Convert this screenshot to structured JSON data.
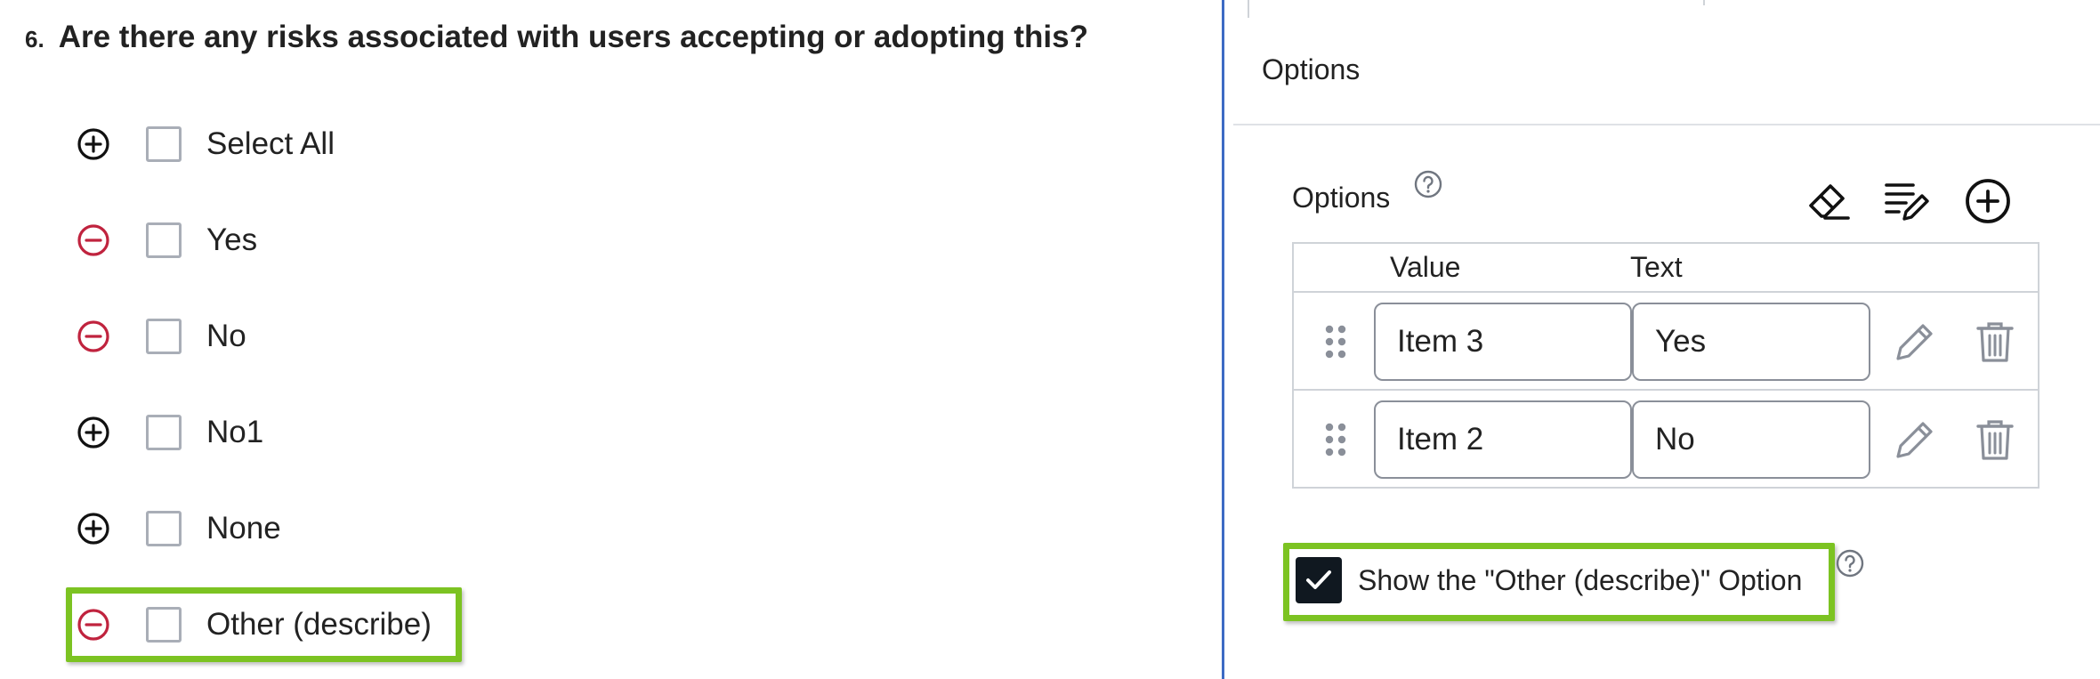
{
  "question": {
    "number": "6.",
    "title": "Are there any risks associated with users accepting or adopting this?",
    "choices": [
      {
        "label": "Select All",
        "op": "add"
      },
      {
        "label": "Yes",
        "op": "remove"
      },
      {
        "label": "No",
        "op": "remove"
      },
      {
        "label": "No1",
        "op": "add"
      },
      {
        "label": "None",
        "op": "add"
      },
      {
        "label": "Other (describe)",
        "op": "remove"
      }
    ]
  },
  "panel": {
    "header": "Options",
    "options_label": "Options",
    "columns": {
      "value": "Value",
      "text": "Text"
    },
    "rows": [
      {
        "value": "Item 3",
        "text": "Yes"
      },
      {
        "value": "Item 2",
        "text": "No"
      }
    ],
    "show_other_label": "Show the \"Other (describe)\" Option",
    "show_other_checked": true
  },
  "colors": {
    "highlight": "#7cc322",
    "remove_icon": "#c0233e",
    "add_icon": "#111111",
    "divider": "#3d6bc4",
    "checkbox_checked": "#101820"
  },
  "icons": {
    "add": "plus-circle-icon",
    "remove": "minus-circle-icon",
    "help": "question-circle-icon",
    "clear": "eraser-icon",
    "edit_list": "list-edit-icon",
    "add_option": "plus-circle-icon",
    "drag": "drag-handle-icon",
    "edit": "pencil-icon",
    "delete": "trash-icon",
    "check": "checkmark-icon"
  }
}
